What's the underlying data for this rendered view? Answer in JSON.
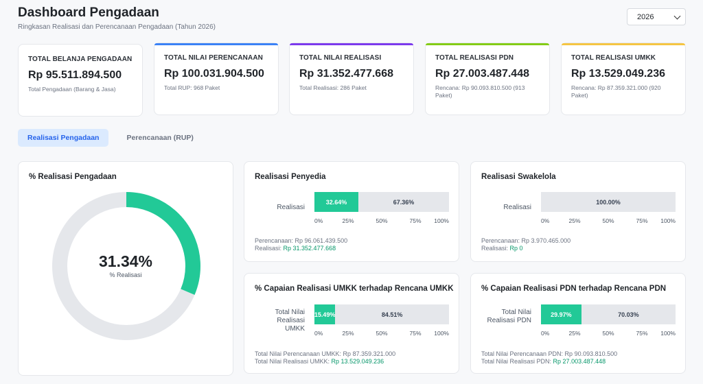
{
  "header": {
    "title": "Dashboard Pengadaan",
    "subtitle": "Ringkasan Realisasi dan Perencanaan Pengadaan (Tahun 2026)",
    "year": "2026"
  },
  "kpis": [
    {
      "label": "TOTAL BELANJA PENGADAAN",
      "value": "Rp 95.511.894.500",
      "note": "Total Pengadaan (Barang & Jasa)",
      "accent": ""
    },
    {
      "label": "TOTAL NILAI PERENCANAAN",
      "value": "Rp 100.031.904.500",
      "note": "Total RUP: 968 Paket",
      "accent": "#3b82f6"
    },
    {
      "label": "TOTAL NILAI REALISASI",
      "value": "Rp 31.352.477.668",
      "note": "Total Realisasi: 286 Paket",
      "accent": "#7c3aed"
    },
    {
      "label": "TOTAL REALISASI PDN",
      "value": "Rp 27.003.487.448",
      "note": "Rencana: Rp 90.093.810.500 (913 Paket)",
      "accent": "#84cc16"
    },
    {
      "label": "TOTAL REALISASI UMKK",
      "value": "Rp 13.529.049.236",
      "note": "Rencana: Rp 87.359.321.000 (920 Paket)",
      "accent": "#f5c542"
    }
  ],
  "tabs": [
    {
      "label": "Realisasi Pengadaan",
      "active": true
    },
    {
      "label": "Perencanaan (RUP)",
      "active": false
    }
  ],
  "donut": {
    "title": "% Realisasi Pengadaan",
    "value_label": "31.34%",
    "caption": "% Realisasi",
    "percent": 31.34,
    "color_fill": "#22c997",
    "color_track": "#e5e7eb"
  },
  "ticks": [
    "0%",
    "25%",
    "50%",
    "75%",
    "100%"
  ],
  "progress_cards": [
    {
      "title": "Realisasi Penyedia",
      "row_label": "Realisasi",
      "green_pct": 32.64,
      "green_label": "32.64%",
      "gray_label": "67.36%",
      "foot1_text": "Perencanaan: Rp 96.061.439.500",
      "foot2_prefix": "Realisasi: ",
      "foot2_value": "Rp 31.352.477.668"
    },
    {
      "title": "Realisasi Swakelola",
      "row_label": "Realisasi",
      "green_pct": 0,
      "green_label": "",
      "gray_label": "100.00%",
      "foot1_text": "Perencanaan: Rp 3.970.465.000",
      "foot2_prefix": "Realisasi: ",
      "foot2_value": "Rp 0"
    },
    {
      "title": "% Capaian Realisasi UMKK terhadap Rencana UMKK",
      "row_label": "Total Nilai Realisasi UMKK",
      "green_pct": 15.49,
      "green_label": "15.49%",
      "gray_label": "84.51%",
      "foot1_text": "Total Nilai Perencanaan UMKK: Rp 87.359.321.000",
      "foot2_prefix": "Total Nilai Realisasi UMKK: ",
      "foot2_value": "Rp 13.529.049.236"
    },
    {
      "title": "% Capaian Realisasi PDN terhadap Rencana PDN",
      "row_label": "Total Nilai Realisasi PDN",
      "green_pct": 29.97,
      "green_label": "29.97%",
      "gray_label": "70.03%",
      "foot1_text": "Total Nilai Perencanaan PDN: Rp 90.093.810.500",
      "foot2_prefix": "Total Nilai Realisasi PDN: ",
      "foot2_value": "Rp 27.003.487.448"
    }
  ]
}
